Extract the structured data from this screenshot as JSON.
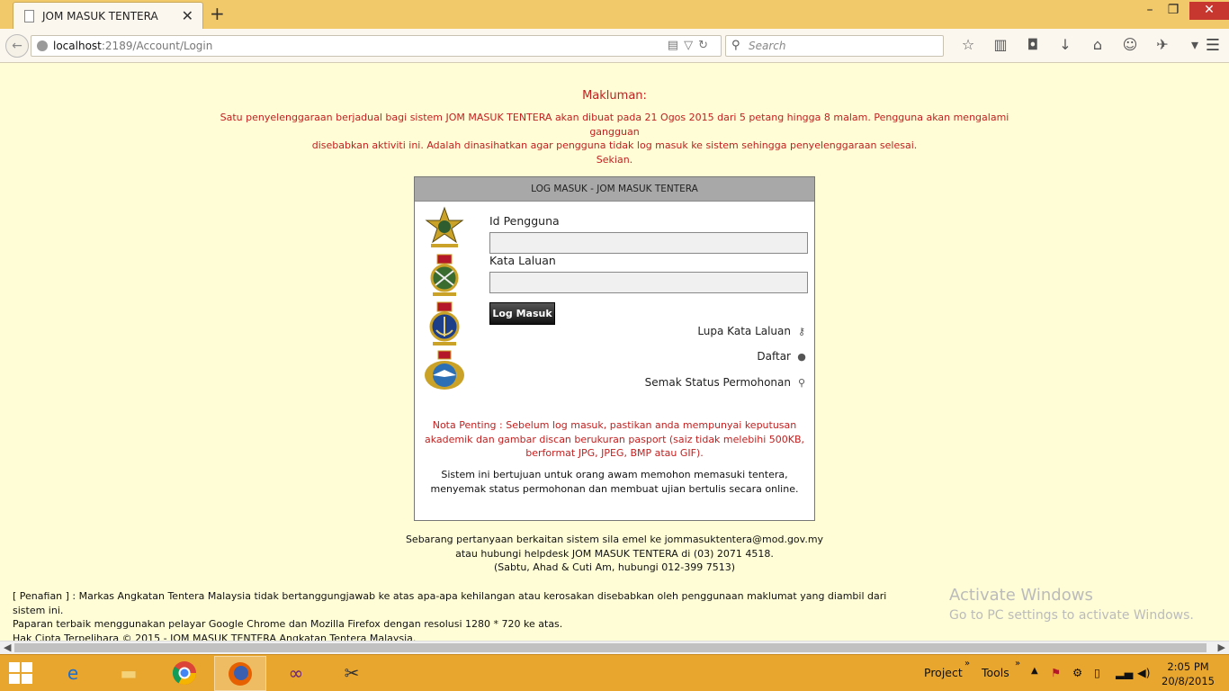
{
  "browser": {
    "tab_title": "JOM MASUK TENTERA",
    "url_host": "localhost",
    "url_path": ":2189/Account/Login",
    "search_placeholder": "Search"
  },
  "notice": {
    "title": "Makluman:",
    "line1": "Satu penyelenggaraan berjadual bagi sistem JOM MASUK TENTERA akan dibuat pada 21 Ogos 2015 dari 5 petang hingga 8 malam. Pengguna akan mengalami gangguan",
    "line2": "disebabkan aktiviti ini. Adalah dinasihatkan agar pengguna tidak log masuk ke sistem sehingga penyelenggaraan selesai.",
    "line3": "Sekian."
  },
  "login": {
    "header": "LOG MASUK - JOM MASUK TENTERA",
    "user_label": "Id Pengguna",
    "password_label": "Kata Laluan",
    "button": "Log Masuk",
    "forgot": "Lupa Kata Laluan",
    "register": "Daftar",
    "status": "Semak Status Permohonan",
    "nota1": "Nota Penting : Sebelum log masuk, pastikan anda mempunyai keputusan",
    "nota2": "akademik dan gambar discan berukuran pasport (saiz tidak melebihi 500KB,",
    "nota3": "berformat JPG, JPEG, BMP atau GIF).",
    "sistem1": "Sistem ini bertujuan untuk orang awam memohon memasuki tentera,",
    "sistem2": "menyemak status permohonan dan membuat ujian bertulis secara online."
  },
  "contact": {
    "line1": "Sebarang pertanyaan berkaitan sistem sila emel ke jommasuktentera@mod.gov.my",
    "line2": "atau hubungi helpdesk JOM MASUK TENTERA di (03) 2071 4518.",
    "line3": "(Sabtu, Ahad & Cuti Am, hubungi 012-399 7513)"
  },
  "footer": {
    "line1": "[ Penafian ] : Markas Angkatan Tentera Malaysia tidak bertanggungjawab ke atas apa-apa kehilangan atau kerosakan disebabkan oleh penggunaan maklumat yang diambil dari sistem ini.",
    "line2": "Paparan terbaik menggunakan pelayar Google Chrome dan Mozilla Firefox dengan resolusi 1280 * 720 ke atas.",
    "line3": "Hak Cipta Terpelihara © 2015 - JOM MASUK TENTERA Angkatan Tentera Malaysia."
  },
  "watermark": {
    "line1": "Activate Windows",
    "line2": "Go to PC settings to activate Windows."
  },
  "taskbar": {
    "project": "Project",
    "tools": "Tools",
    "time": "2:05 PM",
    "date": "20/8/2015"
  },
  "colors": {
    "page_bg": "#fffdd6",
    "notice_red": "#c21f1f",
    "tabbar": "#f2c96a",
    "taskbar": "#e9a62f"
  }
}
